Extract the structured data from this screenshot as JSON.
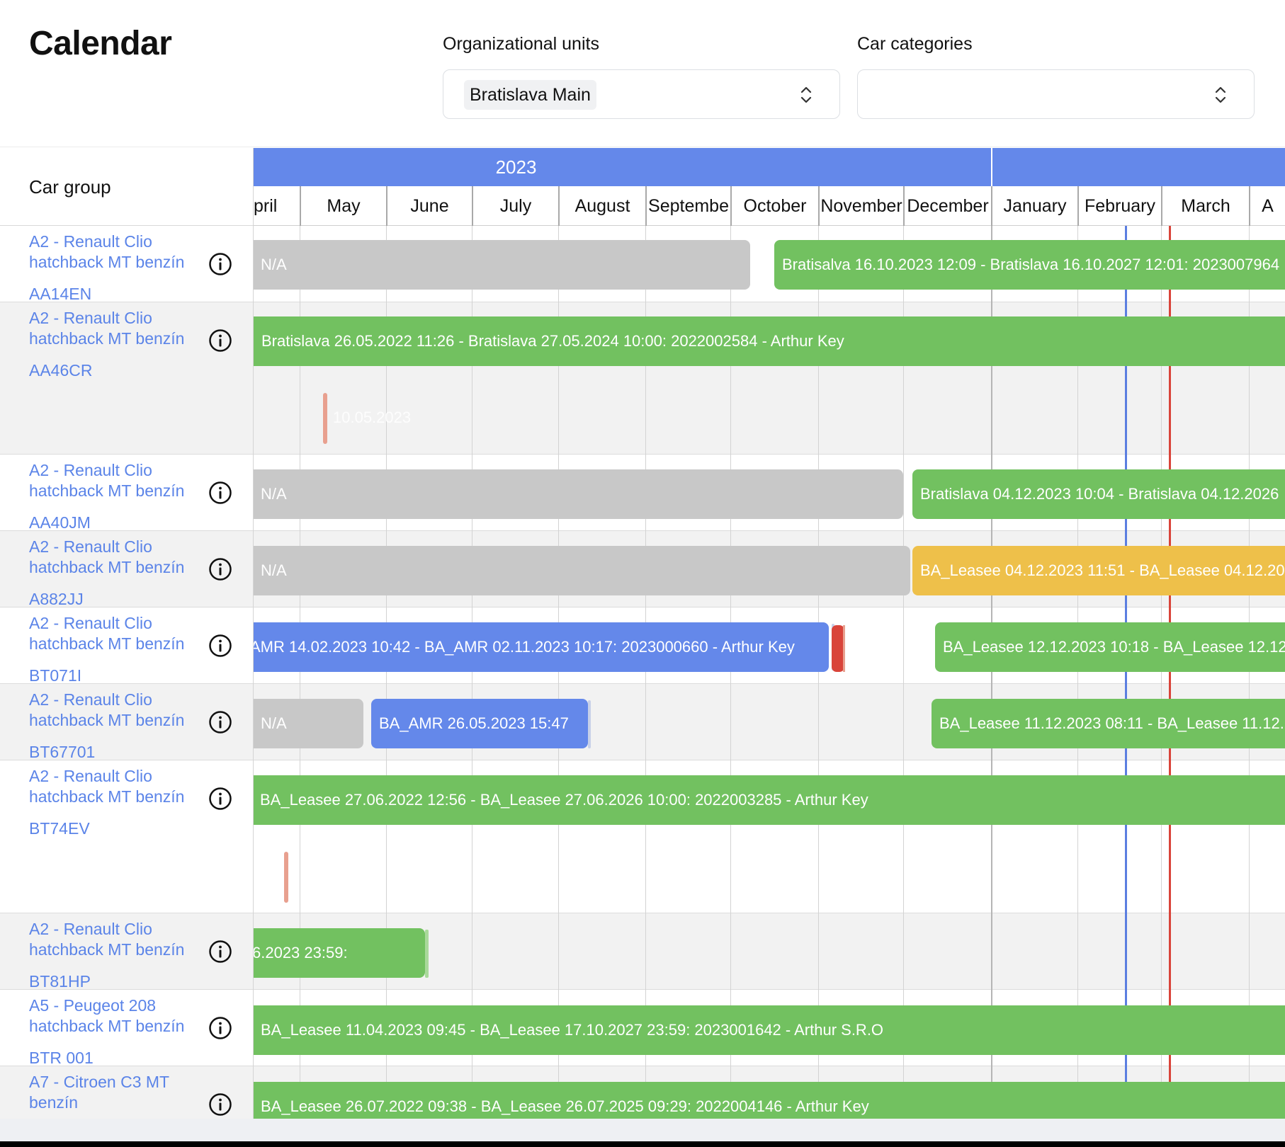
{
  "header": {
    "title": "Calendar"
  },
  "filters": {
    "org_units_label": "Organizational units",
    "org_units_value": "Bratislava Main",
    "car_categories_label": "Car categories",
    "car_categories_value": ""
  },
  "timeline": {
    "car_group_label": "Car group",
    "year": "2023",
    "months": [
      "pril",
      "May",
      "June",
      "July",
      "August",
      "Septembe",
      "October",
      "November",
      "December",
      "January",
      "February",
      "March",
      "A"
    ]
  },
  "rows": [
    {
      "name": "A2 - Renault Clio hatchback MT benzín",
      "plate": "AA14EN"
    },
    {
      "name": "A2 - Renault Clio hatchback MT benzín",
      "plate": "AA46CR"
    },
    {
      "name": "A2 - Renault Clio hatchback MT benzín",
      "plate": "AA40JM"
    },
    {
      "name": "A2 - Renault Clio hatchback MT benzín",
      "plate": "A882JJ"
    },
    {
      "name": "A2 - Renault Clio hatchback MT benzín",
      "plate": "BT071I"
    },
    {
      "name": "A2 - Renault Clio hatchback MT benzín",
      "plate": "BT67701"
    },
    {
      "name": "A2 - Renault Clio hatchback MT benzín",
      "plate": "BT74EV"
    },
    {
      "name": "A2 - Renault Clio hatchback MT benzín",
      "plate": "BT81HP"
    },
    {
      "name": "A5 - Peugeot 208 hatchback MT benzín",
      "plate": "BTR 001"
    },
    {
      "name": "A7 - Citroen C3 MT benzín",
      "plate": ""
    }
  ],
  "bars": {
    "r1_na": "N/A",
    "r1_green": "Bratisalva 16.10.2023 12:09 - Bratislava 16.10.2027 12:01: 2023007964",
    "r2_green": "Bratislava 26.05.2022 11:26 - Bratislava 27.05.2024 10:00: 2022002584 - Arthur Key",
    "r2_ghost": "10.05.2023",
    "r3_na": "N/A",
    "r3_green": "Bratislava 04.12.2023 10:04 - Bratislava 04.12.2026",
    "r4_na": "N/A",
    "r4_yellow": "BA_Leasee 04.12.2023 11:51 - BA_Leasee 04.12.202",
    "r5_blue": "AMR 14.02.2023 10:42 - BA_AMR 02.11.2023 10:17: 2023000660 - Arthur Key",
    "r5_green": "BA_Leasee 12.12.2023 10:18 - BA_Leasee 12.12.",
    "r6_na": "N/A",
    "r6_blue": "BA_AMR 26.05.2023 15:47",
    "r6_green": "BA_Leasee 11.12.2023 08:11 - BA_Leasee 11.12.2",
    "r7_green": "BA_Leasee 27.06.2022 12:56 - BA_Leasee 27.06.2026 10:00: 2022003285 - Arthur Key",
    "r8_green": "6.2023 23:59:",
    "r9_green": "BA_Leasee 11.04.2023 09:45 - BA_Leasee 17.10.2027 23:59: 2023001642 - Arthur S.R.O",
    "r10_green": "BA_Leasee 26.07.2022 09:38 - BA_Leasee 26.07.2025 09:29: 2022004146 - Arthur Key"
  },
  "colors": {
    "accent_blue": "#6488ea",
    "green": "#72c160",
    "grey": "#c8c8c8",
    "yellow": "#eec04a",
    "today_red": "#d9443a",
    "link_blue": "#5b84e8"
  }
}
